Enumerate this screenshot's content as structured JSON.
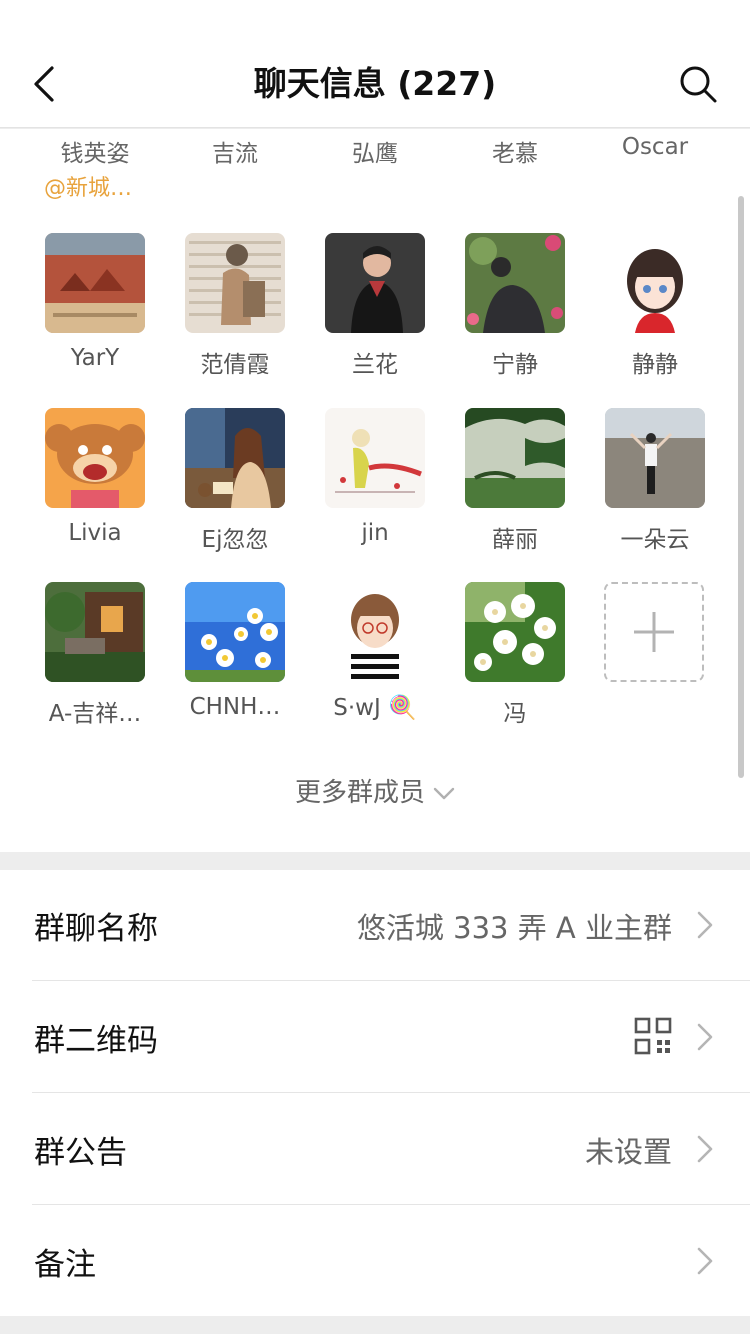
{
  "header": {
    "title": "聊天信息 (227)"
  },
  "partial_members": [
    "钱英姿",
    "吉流",
    "弘鹰",
    "老慕",
    "Oscar"
  ],
  "mention_text": "@新城…",
  "members": [
    {
      "name": "YarY",
      "avatar": "palace-painting"
    },
    {
      "name": "范倩霞",
      "avatar": "woman-illustration"
    },
    {
      "name": "兰花",
      "avatar": "woman-portrait"
    },
    {
      "name": "宁静",
      "avatar": "woman-flowers"
    },
    {
      "name": "静静",
      "avatar": "cartoon-girl"
    },
    {
      "name": "Livia",
      "avatar": "cartoon-cat"
    },
    {
      "name": "Ej忽忽",
      "avatar": "reading-girl"
    },
    {
      "name": "jin",
      "avatar": "sketch-figure"
    },
    {
      "name": "薛丽",
      "avatar": "tree-landscape"
    },
    {
      "name": "一朵云",
      "avatar": "beach-person"
    },
    {
      "name": "A-吉祥…",
      "avatar": "garden-house"
    },
    {
      "name": "CHNH…",
      "avatar": "blue-flowers"
    },
    {
      "name": "S·wJ 🍭",
      "avatar": "cartoon-boy"
    },
    {
      "name": "冯",
      "avatar": "white-blossoms"
    }
  ],
  "more_members_label": "更多群成员",
  "settings": [
    {
      "label": "群聊名称",
      "value": "悠活城 333 弄 A 业主群"
    },
    {
      "label": "群二维码",
      "value": ""
    },
    {
      "label": "群公告",
      "value": "未设置"
    },
    {
      "label": "备注",
      "value": ""
    }
  ]
}
